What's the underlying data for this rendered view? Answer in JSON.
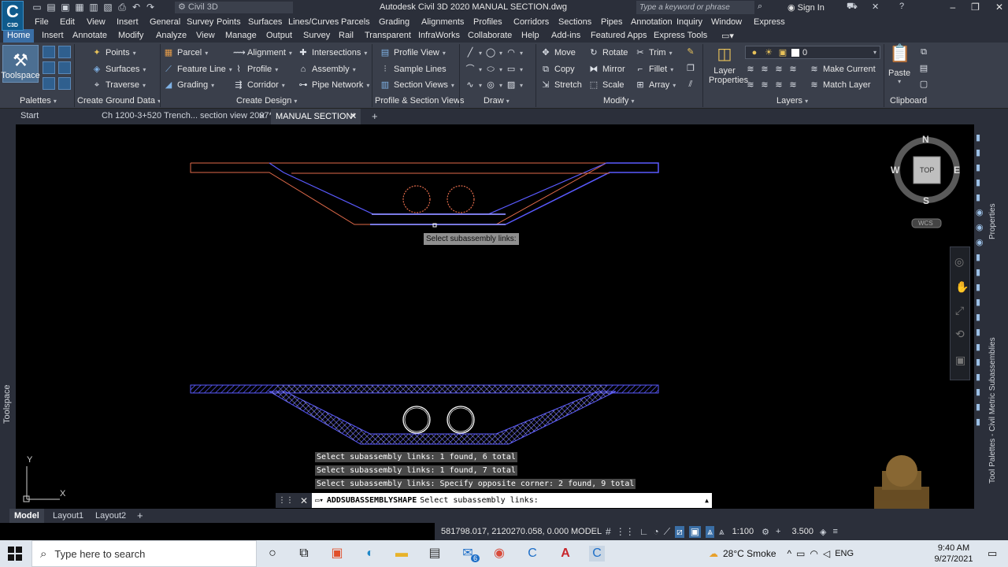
{
  "app": {
    "logo_text": "C",
    "logo_sub": "C3D",
    "workspace": "Civil 3D",
    "title": "Autodesk Civil 3D 2020    MANUAL SECTION.dwg",
    "search_placeholder": "Type a keyword or phrase",
    "sign_in": "Sign In"
  },
  "menu": [
    "File",
    "Edit",
    "View",
    "Insert",
    "General",
    "Survey",
    "Points",
    "Surfaces",
    "Lines/Curves",
    "Parcels",
    "Grading",
    "Alignments",
    "Profiles",
    "Corridors",
    "Sections",
    "Pipes",
    "Annotation",
    "Inquiry",
    "Window",
    "Express"
  ],
  "ribbon_tabs": [
    "Home",
    "Insert",
    "Annotate",
    "Modify",
    "Analyze",
    "View",
    "Manage",
    "Output",
    "Survey",
    "Rail",
    "Transparent",
    "InfraWorks",
    "Collaborate",
    "Help",
    "Add-ins",
    "Featured Apps",
    "Express Tools"
  ],
  "ribbon": {
    "toolspace": "Toolspace",
    "palettes": "Palettes",
    "ground": {
      "points": "Points",
      "surfaces": "Surfaces",
      "traverse": "Traverse",
      "title": "Create Ground Data"
    },
    "design": {
      "parcel": "Parcel",
      "feature_line": "Feature Line",
      "grading": "Grading",
      "alignment": "Alignment",
      "profile": "Profile",
      "corridor": "Corridor",
      "intersections": "Intersections",
      "assembly": "Assembly",
      "pipe_network": "Pipe Network",
      "title": "Create Design"
    },
    "profile_section": {
      "profile_view": "Profile View",
      "sample_lines": "Sample Lines",
      "section_views": "Section Views",
      "title": "Profile & Section Views"
    },
    "draw": {
      "title": "Draw"
    },
    "modify": {
      "move": "Move",
      "rotate": "Rotate",
      "trim": "Trim",
      "copy": "Copy",
      "mirror": "Mirror",
      "fillet": "Fillet",
      "stretch": "Stretch",
      "scale": "Scale",
      "array": "Array",
      "title": "Modify"
    },
    "layers": {
      "layer_properties": "Layer Properties",
      "current_layer": "0",
      "make_current": "Make Current",
      "match_layer": "Match Layer",
      "title": "Layers"
    },
    "clipboard": {
      "paste": "Paste",
      "title": "Clipboard"
    }
  },
  "doc_tabs": [
    "Start",
    "Ch 1200-3+520 Trench... section view 2007*",
    "MANUAL SECTION*"
  ],
  "viewcube": {
    "n": "N",
    "s": "S",
    "e": "E",
    "w": "W",
    "face": "TOP",
    "wcs": "WCS"
  },
  "canvas": {
    "tooltip": "Select subassembly links:",
    "ucs_y": "Y",
    "ucs_x": "X"
  },
  "history": [
    "Select subassembly links: 1 found, 6 total",
    "Select subassembly links: 1 found, 7 total",
    "Select subassembly links: Specify opposite corner: 2 found, 9 total"
  ],
  "command": {
    "name": "ADDSUBASSEMBLYSHAPE",
    "prompt": "Select subassembly links:"
  },
  "side_panels": {
    "left": "Toolspace",
    "right_props": "Properties",
    "right_tools": "Tool Palettes - Civil Metric Subassemblies"
  },
  "layout_tabs": [
    "Model",
    "Layout1",
    "Layout2"
  ],
  "status": {
    "coords": "581798.017, 2120270.058, 0.000",
    "model": "MODEL",
    "scale": "1:100",
    "value": "3.500"
  },
  "taskbar": {
    "search_placeholder": "Type here to search",
    "mail_badge": "6",
    "weather": "28°C  Smoke",
    "lang": "ENG",
    "time": "9:40 AM",
    "date": "9/27/2021"
  },
  "colors": {
    "accent": "#3a6ea5",
    "section_blue": "#4b4bff",
    "section_orange": "#e06a4a",
    "canvas": "#000000"
  }
}
